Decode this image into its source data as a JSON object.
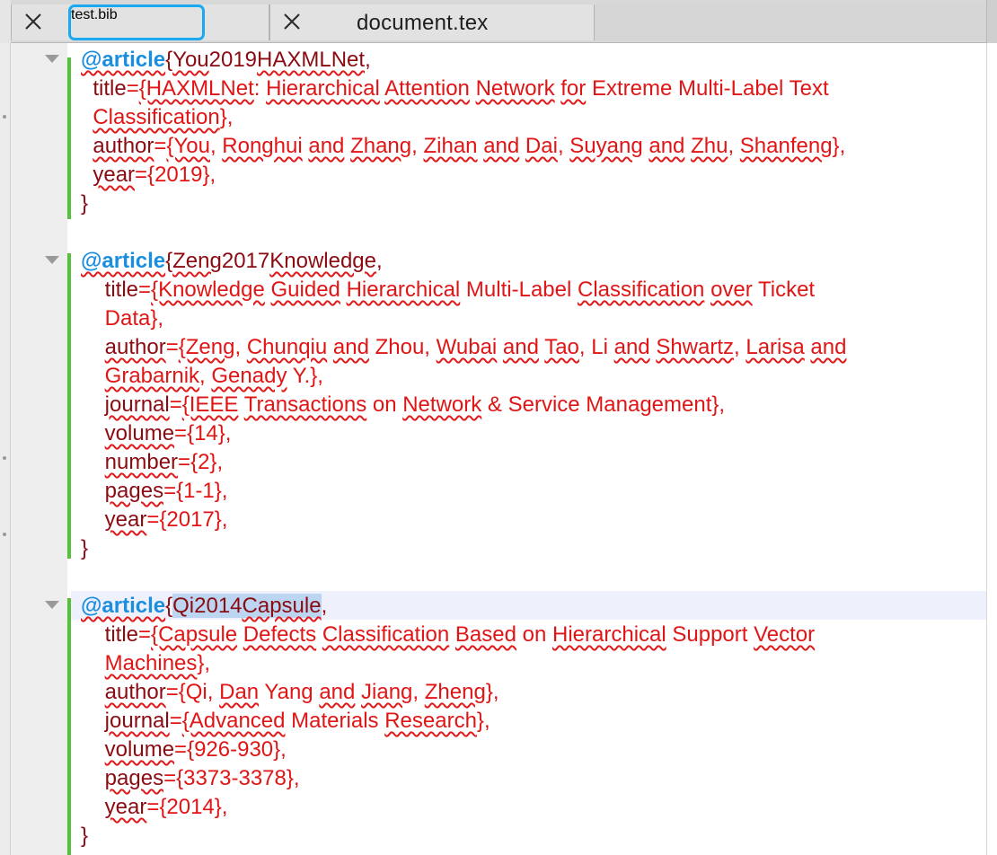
{
  "tabs": [
    {
      "label": "test.bib",
      "active": true
    },
    {
      "label": "document.tex",
      "active": false
    }
  ],
  "colors": {
    "keyword": "#1b8ee0",
    "brace": "#8b0b12",
    "value": "#e01616",
    "change_bar": "#55c13a",
    "active_tab_outline": "#1aa9f0",
    "current_line": "#eef1fb",
    "selection": "#bcd6f1"
  },
  "icons": {
    "tab_close": "close-icon",
    "fold": "fold-triangle-icon"
  },
  "editor": {
    "lines": [
      {
        "segments": [
          [
            "@article",
            "kw sq"
          ],
          [
            "{",
            "brace"
          ],
          [
            "You",
            "key sq"
          ],
          [
            "2019",
            "key"
          ],
          [
            "HAXMLNet",
            "key sq"
          ],
          [
            ",",
            "brace"
          ]
        ]
      },
      {
        "segments": [
          [
            "  title",
            "field"
          ],
          [
            "=",
            "val"
          ],
          [
            "{HAXMLNet",
            "val sq"
          ],
          [
            ": ",
            "val"
          ],
          [
            "Hierarchical",
            "val sq"
          ],
          [
            " ",
            "val"
          ],
          [
            "Attention",
            "val sq"
          ],
          [
            " ",
            "val"
          ],
          [
            "Network",
            "val sq"
          ],
          [
            " ",
            "val"
          ],
          [
            "for",
            "val sq"
          ],
          [
            " Extreme Multi-Label Text",
            "val"
          ]
        ]
      },
      {
        "segments": [
          [
            "  ",
            "val"
          ],
          [
            "Classification",
            "val sq"
          ],
          [
            "},",
            "val"
          ]
        ]
      },
      {
        "segments": [
          [
            "  ",
            "field"
          ],
          [
            "author",
            "field sq"
          ],
          [
            "=",
            "val"
          ],
          [
            "{You",
            "val sq"
          ],
          [
            ", ",
            "val"
          ],
          [
            "Ronghui",
            "val sq"
          ],
          [
            " ",
            "val"
          ],
          [
            "and",
            "val sq"
          ],
          [
            " ",
            "val"
          ],
          [
            "Zhang",
            "val sq"
          ],
          [
            ", ",
            "val"
          ],
          [
            "Zihan",
            "val sq"
          ],
          [
            " ",
            "val"
          ],
          [
            "and",
            "val sq"
          ],
          [
            " ",
            "val"
          ],
          [
            "Dai",
            "val sq"
          ],
          [
            ", ",
            "val"
          ],
          [
            "Suyang",
            "val sq"
          ],
          [
            " ",
            "val"
          ],
          [
            "and",
            "val sq"
          ],
          [
            " ",
            "val"
          ],
          [
            "Zhu",
            "val sq"
          ],
          [
            ", ",
            "val"
          ],
          [
            "Shanfeng",
            "val sq"
          ],
          [
            "},",
            "val"
          ]
        ]
      },
      {
        "segments": [
          [
            "  ",
            "field"
          ],
          [
            "year",
            "field sq"
          ],
          [
            "={2019},",
            "val"
          ]
        ]
      },
      {
        "segments": [
          [
            "}",
            "brace"
          ]
        ]
      },
      {
        "segments": [
          [
            "",
            "val"
          ]
        ]
      },
      {
        "segments": [
          [
            "@article",
            "kw sq"
          ],
          [
            "{",
            "brace"
          ],
          [
            "Zeng",
            "key sq"
          ],
          [
            "2017",
            "key"
          ],
          [
            "Knowledge",
            "key sq"
          ],
          [
            ",",
            "brace"
          ]
        ]
      },
      {
        "segments": [
          [
            "    title",
            "field"
          ],
          [
            "=",
            "val"
          ],
          [
            "{Knowledge",
            "val sq"
          ],
          [
            " ",
            "val"
          ],
          [
            "Guided",
            "val sq"
          ],
          [
            " ",
            "val"
          ],
          [
            "Hierarchical",
            "val sq"
          ],
          [
            " Multi-Label ",
            "val"
          ],
          [
            "Classification",
            "val sq"
          ],
          [
            " ",
            "val"
          ],
          [
            "over",
            "val sq"
          ],
          [
            " Ticket",
            "val"
          ]
        ]
      },
      {
        "segments": [
          [
            "    Data},",
            "val"
          ]
        ]
      },
      {
        "segments": [
          [
            "    ",
            "field"
          ],
          [
            "author",
            "field sq"
          ],
          [
            "=",
            "val"
          ],
          [
            "{Zeng",
            "val sq"
          ],
          [
            ", ",
            "val"
          ],
          [
            "Chunqiu",
            "val sq"
          ],
          [
            " ",
            "val"
          ],
          [
            "and",
            "val sq"
          ],
          [
            " Zhou, ",
            "val"
          ],
          [
            "Wubai",
            "val sq"
          ],
          [
            " ",
            "val"
          ],
          [
            "and",
            "val sq"
          ],
          [
            " ",
            "val"
          ],
          [
            "Tao",
            "val sq"
          ],
          [
            ", Li ",
            "val"
          ],
          [
            "and",
            "val sq"
          ],
          [
            " ",
            "val"
          ],
          [
            "Shwartz",
            "val sq"
          ],
          [
            ", ",
            "val"
          ],
          [
            "Larisa",
            "val sq"
          ],
          [
            " ",
            "val"
          ],
          [
            "and",
            "val sq"
          ]
        ]
      },
      {
        "segments": [
          [
            "    ",
            "val"
          ],
          [
            "Grabarnik",
            "val sq"
          ],
          [
            ", ",
            "val"
          ],
          [
            "Genady",
            "val sq"
          ],
          [
            " Y.},",
            "val"
          ]
        ]
      },
      {
        "segments": [
          [
            "    ",
            "field"
          ],
          [
            "journal",
            "field sq"
          ],
          [
            "=",
            "val"
          ],
          [
            "{IEEE",
            "val sq"
          ],
          [
            " ",
            "val"
          ],
          [
            "Transactions",
            "val sq"
          ],
          [
            " on ",
            "val"
          ],
          [
            "Network",
            "val sq"
          ],
          [
            " & Service Management},",
            "val"
          ]
        ]
      },
      {
        "segments": [
          [
            "    ",
            "field"
          ],
          [
            "volume",
            "field sq"
          ],
          [
            "={14},",
            "val"
          ]
        ]
      },
      {
        "segments": [
          [
            "    ",
            "field"
          ],
          [
            "number",
            "field sq"
          ],
          [
            "={2},",
            "val"
          ]
        ]
      },
      {
        "segments": [
          [
            "    ",
            "field"
          ],
          [
            "pages",
            "field sq"
          ],
          [
            "={1-1},",
            "val"
          ]
        ]
      },
      {
        "segments": [
          [
            "    ",
            "field"
          ],
          [
            "year",
            "field sq"
          ],
          [
            "={2017},",
            "val"
          ]
        ]
      },
      {
        "segments": [
          [
            "}",
            "brace"
          ]
        ]
      },
      {
        "segments": [
          [
            "",
            "val"
          ]
        ]
      },
      {
        "segments": [
          [
            "@article",
            "kw sq"
          ],
          [
            "{",
            "brace"
          ],
          [
            "Qi2014",
            "key sel"
          ],
          [
            "Capsule",
            "key sq sel"
          ],
          [
            ",",
            "brace"
          ]
        ]
      },
      {
        "segments": [
          [
            "    title",
            "field"
          ],
          [
            "=",
            "val"
          ],
          [
            "{Capsule",
            "val sq"
          ],
          [
            " ",
            "val"
          ],
          [
            "Defects",
            "val sq"
          ],
          [
            " ",
            "val"
          ],
          [
            "Classification",
            "val sq"
          ],
          [
            " ",
            "val"
          ],
          [
            "Based",
            "val sq"
          ],
          [
            " on ",
            "val"
          ],
          [
            "Hierarchical",
            "val sq"
          ],
          [
            " Support ",
            "val"
          ],
          [
            "Vector",
            "val sq"
          ]
        ]
      },
      {
        "segments": [
          [
            "    ",
            "val"
          ],
          [
            "Machines",
            "val sq"
          ],
          [
            "},",
            "val"
          ]
        ]
      },
      {
        "segments": [
          [
            "    ",
            "field"
          ],
          [
            "author",
            "field sq"
          ],
          [
            "={Qi, ",
            "val"
          ],
          [
            "Dan",
            "val sq"
          ],
          [
            " Yang ",
            "val"
          ],
          [
            "and",
            "val sq"
          ],
          [
            " ",
            "val"
          ],
          [
            "Jiang",
            "val sq"
          ],
          [
            ", ",
            "val"
          ],
          [
            "Zheng",
            "val sq"
          ],
          [
            "},",
            "val"
          ]
        ]
      },
      {
        "segments": [
          [
            "    ",
            "field"
          ],
          [
            "journal",
            "field sq"
          ],
          [
            "=",
            "val"
          ],
          [
            "{Advanced",
            "val sq"
          ],
          [
            " Materials ",
            "val"
          ],
          [
            "Research",
            "val sq"
          ],
          [
            "},",
            "val"
          ]
        ]
      },
      {
        "segments": [
          [
            "    ",
            "field"
          ],
          [
            "volume",
            "field sq"
          ],
          [
            "={926-930},",
            "val"
          ]
        ]
      },
      {
        "segments": [
          [
            "    ",
            "field"
          ],
          [
            "pages",
            "field sq"
          ],
          [
            "={3373-3378},",
            "val"
          ]
        ]
      },
      {
        "segments": [
          [
            "    ",
            "field"
          ],
          [
            "year",
            "field sq"
          ],
          [
            "={2014},",
            "val"
          ]
        ]
      },
      {
        "segments": [
          [
            "}",
            "brace"
          ]
        ]
      }
    ]
  }
}
